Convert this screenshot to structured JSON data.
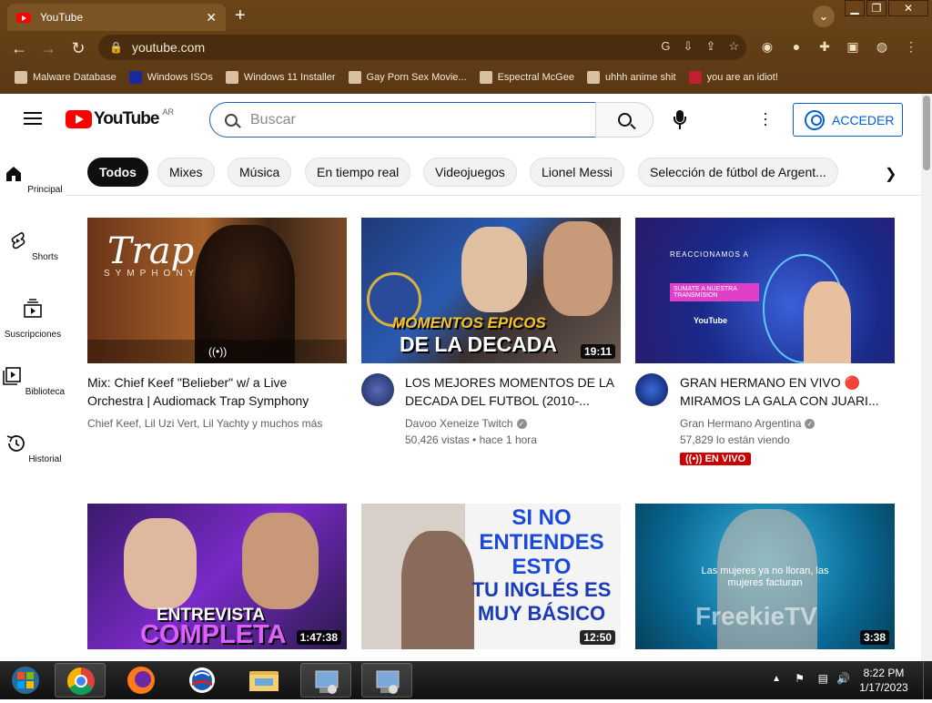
{
  "browser": {
    "tab_title": "YouTube",
    "url": "youtube.com",
    "bookmarks": [
      {
        "label": "Malware Database"
      },
      {
        "label": "Windows ISOs"
      },
      {
        "label": "Windows 11 Installer"
      },
      {
        "label": "Gay Porn Sex Movie..."
      },
      {
        "label": "Espectral McGee"
      },
      {
        "label": "uhhh anime shit"
      },
      {
        "label": "you are an idiot!"
      }
    ]
  },
  "youtube": {
    "logo_text": "YouTube",
    "country_code": "AR",
    "search_placeholder": "Buscar",
    "signin_label": "ACCEDER",
    "sidebar": [
      {
        "label": "Principal",
        "icon": "home-icon"
      },
      {
        "label": "Shorts",
        "icon": "shorts-icon"
      },
      {
        "label": "Suscripciones",
        "icon": "subscriptions-icon"
      },
      {
        "label": "Biblioteca",
        "icon": "library-icon"
      },
      {
        "label": "Historial",
        "icon": "history-icon"
      }
    ],
    "chips": [
      "Todos",
      "Mixes",
      "Música",
      "En tiempo real",
      "Videojuegos",
      "Lionel Messi",
      "Selección de fútbol de Argent..."
    ],
    "videos": [
      {
        "title": "Mix: Chief Keef \"Belieber\" w/ a Live Orchestra | Audiomack Trap Symphony",
        "channel": "Chief Keef, Lil Uzi Vert, Lil Yachty y muchos más",
        "meta": "",
        "duration": "",
        "thumb_text": "Trap",
        "thumb_sub": "SYMPHONY"
      },
      {
        "title": "LOS MEJORES MOMENTOS DE LA DECADA DEL FUTBOL (2010-...",
        "channel": "Davoo Xeneize Twitch",
        "meta": "50,426 vistas • hace 1 hora",
        "duration": "19:11",
        "thumb_text": "MOMENTOS EPICOS",
        "thumb_sub": "DE LA DECADA"
      },
      {
        "title": "GRAN HERMANO EN VIVO 🔴 MIRAMOS LA GALA CON JUARI...",
        "channel": "Gran Hermano Argentina",
        "meta": "57,829 lo están viendo",
        "duration": "",
        "live_label": "EN VIVO",
        "thumb_text": "REACCIONAMOS A",
        "thumb_sub": "SUMATE A NUESTRA TRANSMISION"
      },
      {
        "title": "",
        "channel": "",
        "meta": "",
        "duration": "1:47:38",
        "thumb_text": "ENTREVISTA",
        "thumb_sub": "COMPLETA"
      },
      {
        "title": "",
        "channel": "",
        "meta": "",
        "duration": "12:50",
        "thumb_text": "SI NO ENTIENDES ESTO",
        "thumb_sub": "TU INGLÉS ES MUY BÁSICO"
      },
      {
        "title": "",
        "channel": "",
        "meta": "",
        "duration": "3:38",
        "thumb_text": "Las mujeres ya no lloran, las mujeres facturan",
        "thumb_sub": "FreekieTV"
      }
    ]
  },
  "taskbar": {
    "time": "8:22 PM",
    "date": "1/17/2023"
  },
  "colors": {
    "browser_frame": "#5c3a16",
    "youtube_red": "#ff0000",
    "link_blue": "#065fd4",
    "live_red": "#cc0000"
  }
}
